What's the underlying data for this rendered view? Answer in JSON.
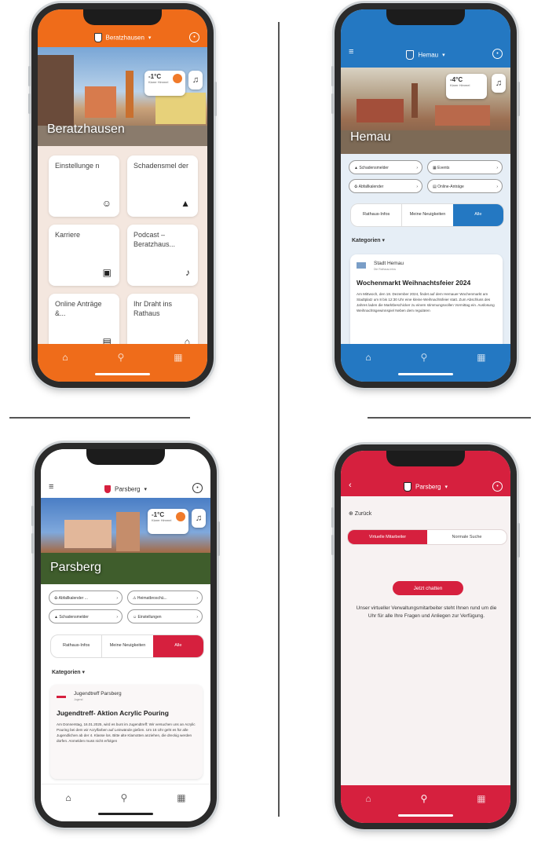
{
  "dividers": true,
  "phones": {
    "beratzhausen": {
      "color": "#ef6c1a",
      "topbar": {
        "location": "Beratzhausen",
        "caret": "▾"
      },
      "hero": {
        "city": "Beratzhausen"
      },
      "weather": {
        "temp": "-1°C",
        "desc": "Klarer Himmel"
      },
      "tiles": [
        {
          "label": "Einstellunge n",
          "icon": "account-icon",
          "glyph": "☺"
        },
        {
          "label": "Schadensmel der",
          "icon": "warning-icon",
          "glyph": "▲"
        },
        {
          "label": "Karriere",
          "icon": "briefcase-icon",
          "glyph": "▣"
        },
        {
          "label": "Podcast – Beratzhaus...",
          "icon": "microphone-icon",
          "glyph": "♪"
        },
        {
          "label": "Online Anträge &...",
          "icon": "document-icon",
          "glyph": "▤"
        },
        {
          "label": "Ihr Draht ins Rathaus",
          "icon": "townhall-icon",
          "glyph": "⌂"
        }
      ],
      "nav": {
        "home": "⌂",
        "search": "⚲",
        "calendar": "▦"
      }
    },
    "hemau": {
      "color": "#2478c2",
      "topbar": {
        "location": "Hemau",
        "caret": "▾"
      },
      "hero": {
        "city": "Hemau"
      },
      "weather": {
        "temp": "-4°C",
        "desc": "Klarer Himmel"
      },
      "chips": [
        "Schadensmelder",
        "Events",
        "Abfallkalender",
        "Online-Anträge"
      ],
      "segments": [
        "Rathaus-Infos",
        "Meine Neuigkeiten",
        "Alle"
      ],
      "categories_label": "Kategorien ▾",
      "post": {
        "source": "Stadt Hemau",
        "source_sub": "Die Rathaus-Infos",
        "title": "Wochenmarkt Weihnachtsfeier 2024",
        "body": "Am Mittwoch, den 18. Dezember 2024, findet auf dem Hemauer Wochenmarkt am Stadtplatz um 8 bis 12:30 Uhr eine kleine Weihnachtsfeier statt. Zum Abschluss des Jahres laden die Marktbeschicker zu einem stimmungsvollen Vormittag ein. Auslosung Weihnachtsgewinnspiel Neben dem regulären"
      },
      "nav": {
        "home": "⌂",
        "search": "⚲",
        "calendar": "▦"
      }
    },
    "parsberg_news": {
      "color": "#d6203e",
      "topbar": {
        "location": "Parsberg",
        "caret": "▾"
      },
      "hero": {
        "city": "Parsberg"
      },
      "weather": {
        "temp": "-1°C",
        "desc": "Klarer Himmel"
      },
      "chips": [
        "Abfallkalender ...",
        "Heimatbroschü...",
        "Schadensmelder",
        "Einstellungen"
      ],
      "segments": [
        "Rathaus-Infos",
        "Meine Neuigkeiten",
        "Alle"
      ],
      "categories_label": "Kategorien ▾",
      "post": {
        "source": "Jugendtreff Parsberg",
        "source_sub": "Jugend",
        "title": "Jugendtreff- Aktion Acrylic Pouring",
        "body": "Am Donnerstag, 16.01.2025, wird es bunt im Jugendtreff: Wir versuchen uns an Acrylic Pouring bei dem wir Acrylfarben auf Leinwände gießen. Um 16 Uhr geht es für alle Jugendlichen ab der 4. Klasse los. Bitte alte Klamotten anziehen, die dreckig werden dürfen. Anmelden muss nicht erfolgen"
      },
      "nav": {
        "home": "⌂",
        "search": "⚲",
        "calendar": "▦"
      }
    },
    "parsberg_chat": {
      "color": "#d6203e",
      "topbar": {
        "location": "Parsberg",
        "caret": "▾",
        "back": "‹"
      },
      "back_link": "⊕ Zurück",
      "tabs": [
        "Virtuelle Mitarbeiter",
        "Normale Suche"
      ],
      "chat_button": "Jetzt chatten",
      "description": "Unser virtueller Verwaltungsmitarbeiter steht Ihnen rund um die Uhr für alle Ihre Fragen und Anliegen zur Verfügung.",
      "nav": {
        "home": "⌂",
        "search": "⚲",
        "calendar": "▦"
      }
    }
  }
}
